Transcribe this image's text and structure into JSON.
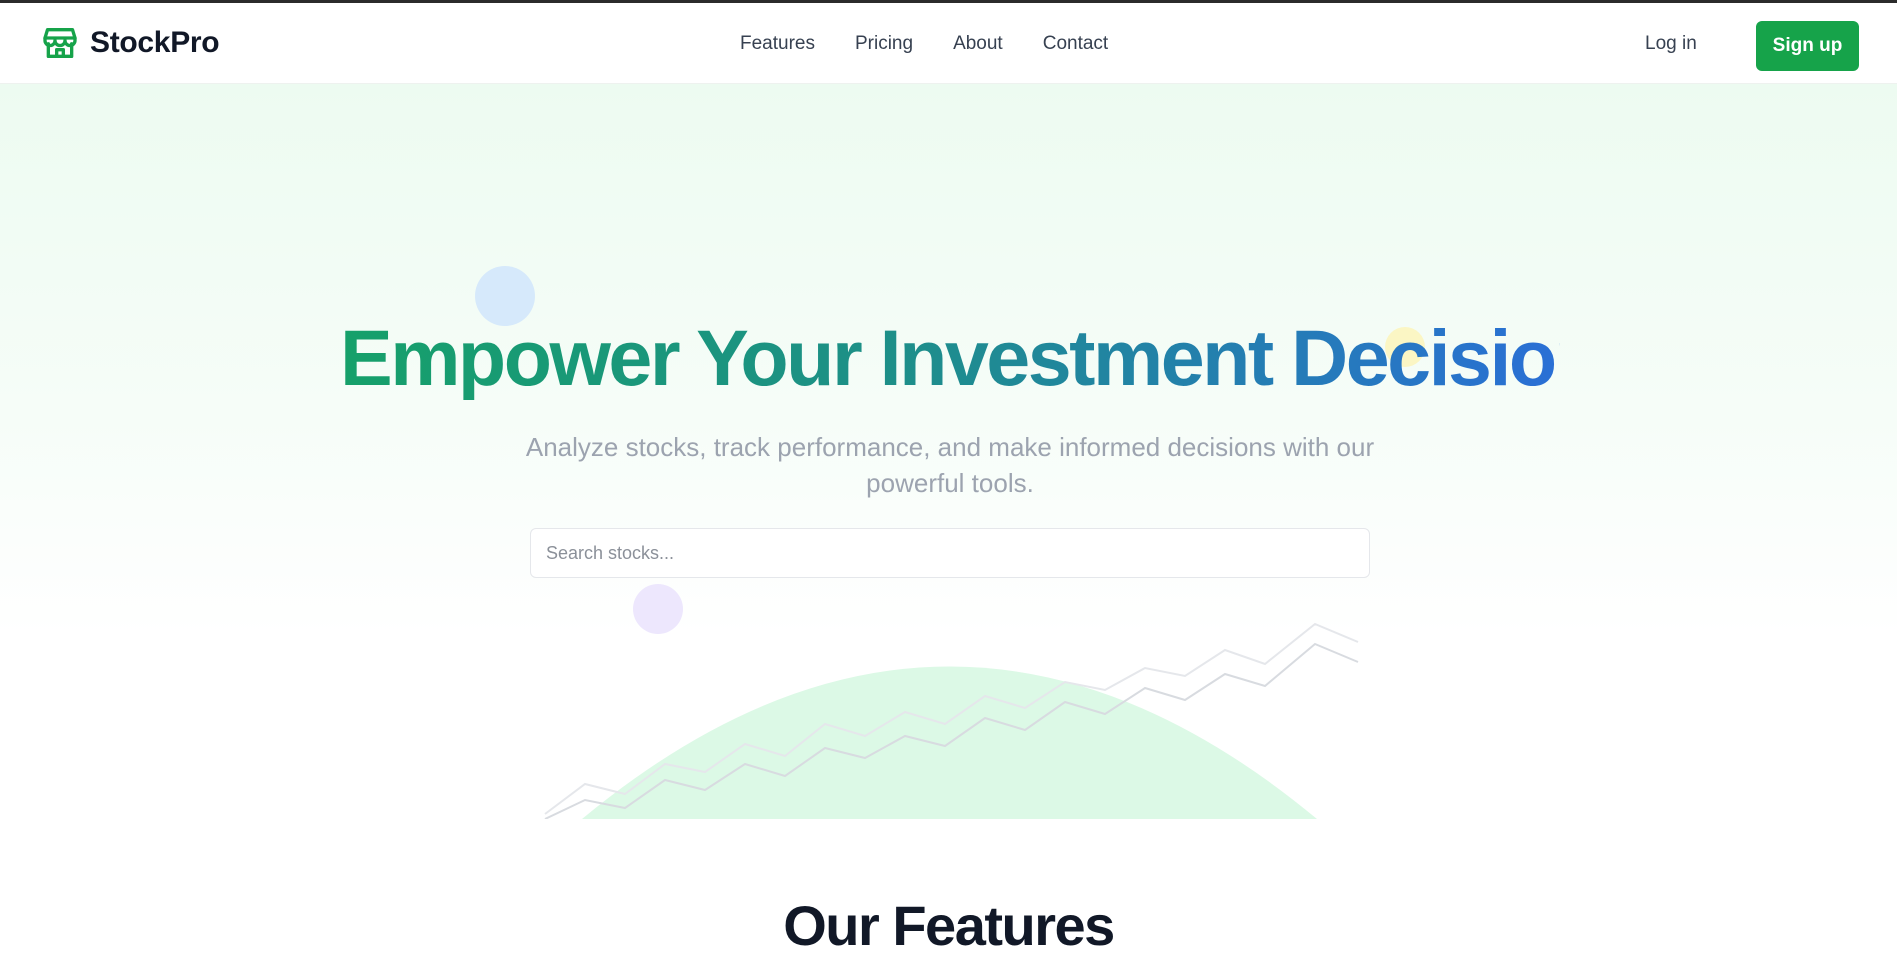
{
  "header": {
    "brand_icon": "storefront-icon",
    "brand_name": "StockPro",
    "nav": [
      {
        "label": "Features"
      },
      {
        "label": "Pricing"
      },
      {
        "label": "About"
      },
      {
        "label": "Contact"
      }
    ],
    "login_label": "Log in",
    "signup_label": "Sign up"
  },
  "hero": {
    "title": "Empower Your Investment Decisions",
    "subtitle": "Analyze stocks, track performance, and make informed decisions with our powerful tools.",
    "search_placeholder": "Search stocks..."
  },
  "features": {
    "title": "Our Features"
  },
  "colors": {
    "brand_green": "#16a34a",
    "title_gradient_start": "#16a06a",
    "title_gradient_end": "#2a6fd6",
    "hero_bg": "#edfbf1"
  }
}
